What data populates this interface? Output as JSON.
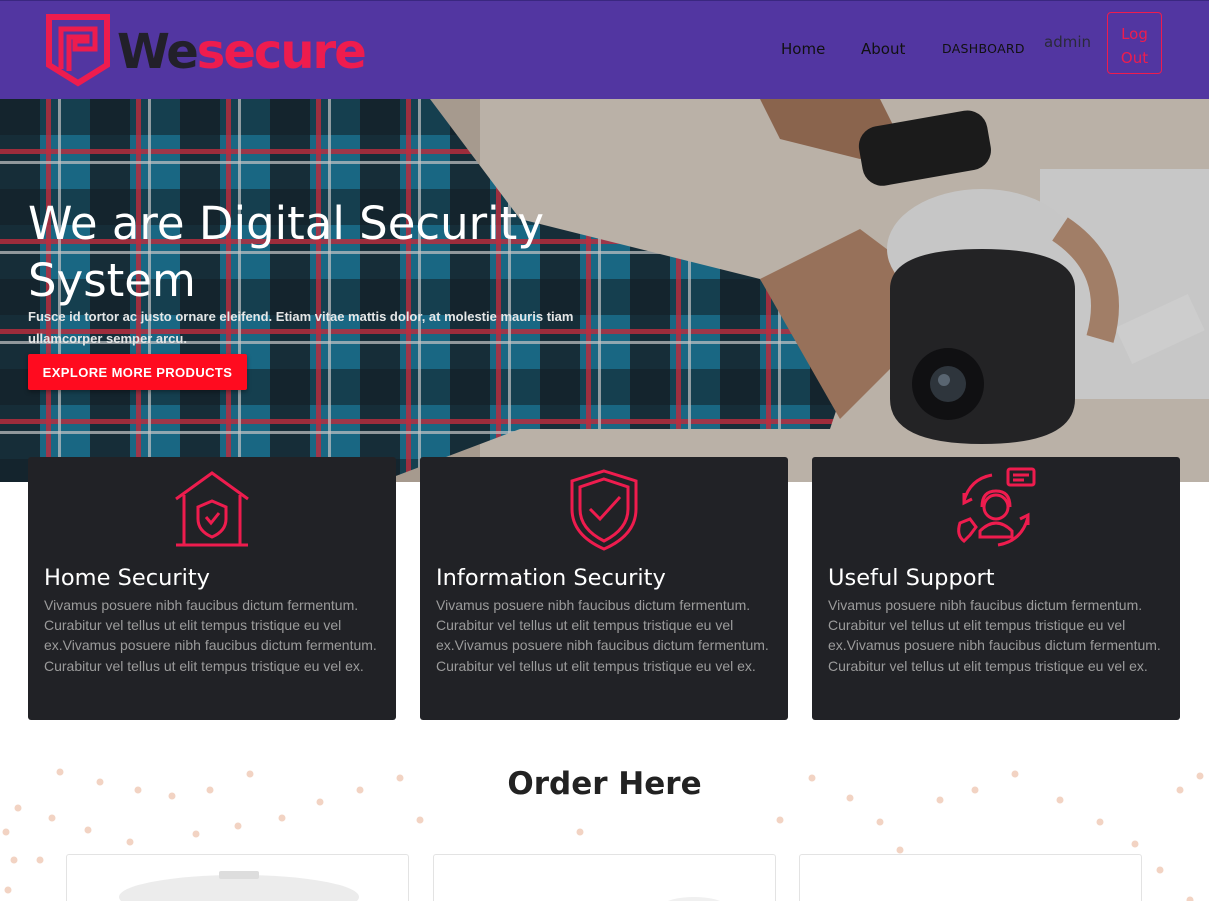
{
  "nav": {
    "brand_part1": "We",
    "brand_part2": "secure",
    "links": [
      "Home",
      "About",
      "DASHBOARD"
    ],
    "user": "admin",
    "logout": "Log Out"
  },
  "hero": {
    "title": "We are Digital Security System",
    "subtitle": "Fusce id tortor ac justo ornare eleifend. Etiam vitae mattis dolor, at molestie mauris tiam ullamcorper semper arcu.",
    "cta": "EXPLORE MORE PRODUCTS"
  },
  "features": [
    {
      "title": "Home Security",
      "icon": "home-shield-icon",
      "text": "Vivamus posuere nibh faucibus dictum fermentum. Curabitur vel tellus ut elit tempus tristique eu vel ex.Vivamus posuere nibh faucibus dictum fermentum. Curabitur vel tellus ut elit tempus tristique eu vel ex."
    },
    {
      "title": "Information Security",
      "icon": "shield-check-icon",
      "text": "Vivamus posuere nibh faucibus dictum fermentum. Curabitur vel tellus ut elit tempus tristique eu vel ex.Vivamus posuere nibh faucibus dictum fermentum. Curabitur vel tellus ut elit tempus tristique eu vel ex."
    },
    {
      "title": "Useful Support",
      "icon": "support-agent-icon",
      "text": "Vivamus posuere nibh faucibus dictum fermentum. Curabitur vel tellus ut elit tempus tristique eu vel ex.Vivamus posuere nibh faucibus dictum fermentum. Curabitur vel tellus ut elit tempus tristique eu vel ex."
    }
  ],
  "order": {
    "title": "Order Here"
  },
  "colors": {
    "nav_bg": "#5236a1",
    "accent": "#ee1c4e",
    "cta": "#ff0b1f",
    "card_bg": "#212226"
  }
}
